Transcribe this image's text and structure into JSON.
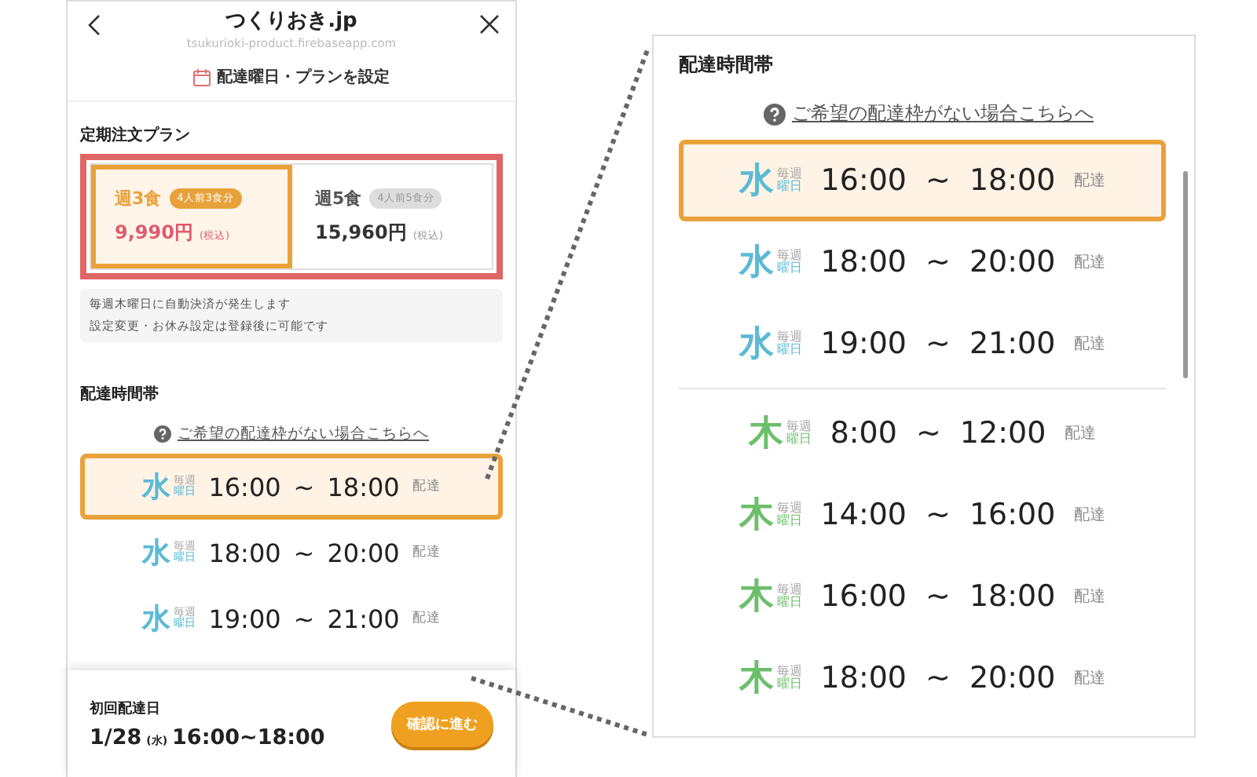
{
  "phone": {
    "header": {
      "title": "つくりおき.jp",
      "url": "tsukurioki-product.firebaseapp.com",
      "heading": "配達曜日・プランを設定"
    },
    "plan_section": {
      "title": "定期注文プラン",
      "highlighted": true,
      "plans": [
        {
          "name": "週3食",
          "badge": "4人前3食分",
          "price": "9,990円",
          "tax": "(税込)",
          "selected": true
        },
        {
          "name": "週5食",
          "badge": "4人前5食分",
          "price": "15,960円",
          "tax": "(税込)",
          "selected": false
        }
      ]
    },
    "notes": [
      "毎週木曜日に自動決済が発生します",
      "設定変更・お休み設定は登録後に可能です"
    ],
    "slots_section": {
      "title": "配達時間帯",
      "help_link": "ご希望の配達枠がない場合こちらへ",
      "slots": [
        {
          "day": "水",
          "every": "毎週",
          "weekday": "曜日",
          "color": "#5bbad5",
          "start": "16:00",
          "tilde": "~",
          "end": "18:00",
          "suffix": "配達",
          "selected": true
        },
        {
          "day": "水",
          "every": "毎週",
          "weekday": "曜日",
          "color": "#5bbad5",
          "start": "18:00",
          "tilde": "~",
          "end": "20:00",
          "suffix": "配達",
          "selected": false
        },
        {
          "day": "水",
          "every": "毎週",
          "weekday": "曜日",
          "color": "#5bbad5",
          "start": "19:00",
          "tilde": "~",
          "end": "21:00",
          "suffix": "配達",
          "selected": false
        }
      ]
    },
    "footer": {
      "label": "初回配達日",
      "date": "1/28",
      "weekday": "(水)",
      "time": "16:00~18:00",
      "button": "確認に進む"
    }
  },
  "zoom_panel": {
    "title": "配達時間帯",
    "help_link": "ご希望の配達枠がない場合こちらへ",
    "slots": [
      {
        "day": "水",
        "every": "毎週",
        "weekday": "曜日",
        "color": "#5bbad5",
        "start": "16:00",
        "tilde": "~",
        "end": "18:00",
        "suffix": "配達",
        "selected": true
      },
      {
        "day": "水",
        "every": "毎週",
        "weekday": "曜日",
        "color": "#5bbad5",
        "start": "18:00",
        "tilde": "~",
        "end": "20:00",
        "suffix": "配達",
        "selected": false
      },
      {
        "day": "水",
        "every": "毎週",
        "weekday": "曜日",
        "color": "#5bbad5",
        "start": "19:00",
        "tilde": "~",
        "end": "21:00",
        "suffix": "配達",
        "selected": false
      },
      {
        "day": "木",
        "every": "毎週",
        "weekday": "曜日",
        "color": "#6cbf6a",
        "start": "8:00",
        "tilde": "~",
        "end": "12:00",
        "suffix": "配達",
        "selected": false
      },
      {
        "day": "木",
        "every": "毎週",
        "weekday": "曜日",
        "color": "#6cbf6a",
        "start": "14:00",
        "tilde": "~",
        "end": "16:00",
        "suffix": "配達",
        "selected": false
      },
      {
        "day": "木",
        "every": "毎週",
        "weekday": "曜日",
        "color": "#6cbf6a",
        "start": "16:00",
        "tilde": "~",
        "end": "18:00",
        "suffix": "配達",
        "selected": false
      },
      {
        "day": "木",
        "every": "毎週",
        "weekday": "曜日",
        "color": "#6cbf6a",
        "start": "18:00",
        "tilde": "~",
        "end": "20:00",
        "suffix": "配達",
        "selected": false
      }
    ]
  }
}
